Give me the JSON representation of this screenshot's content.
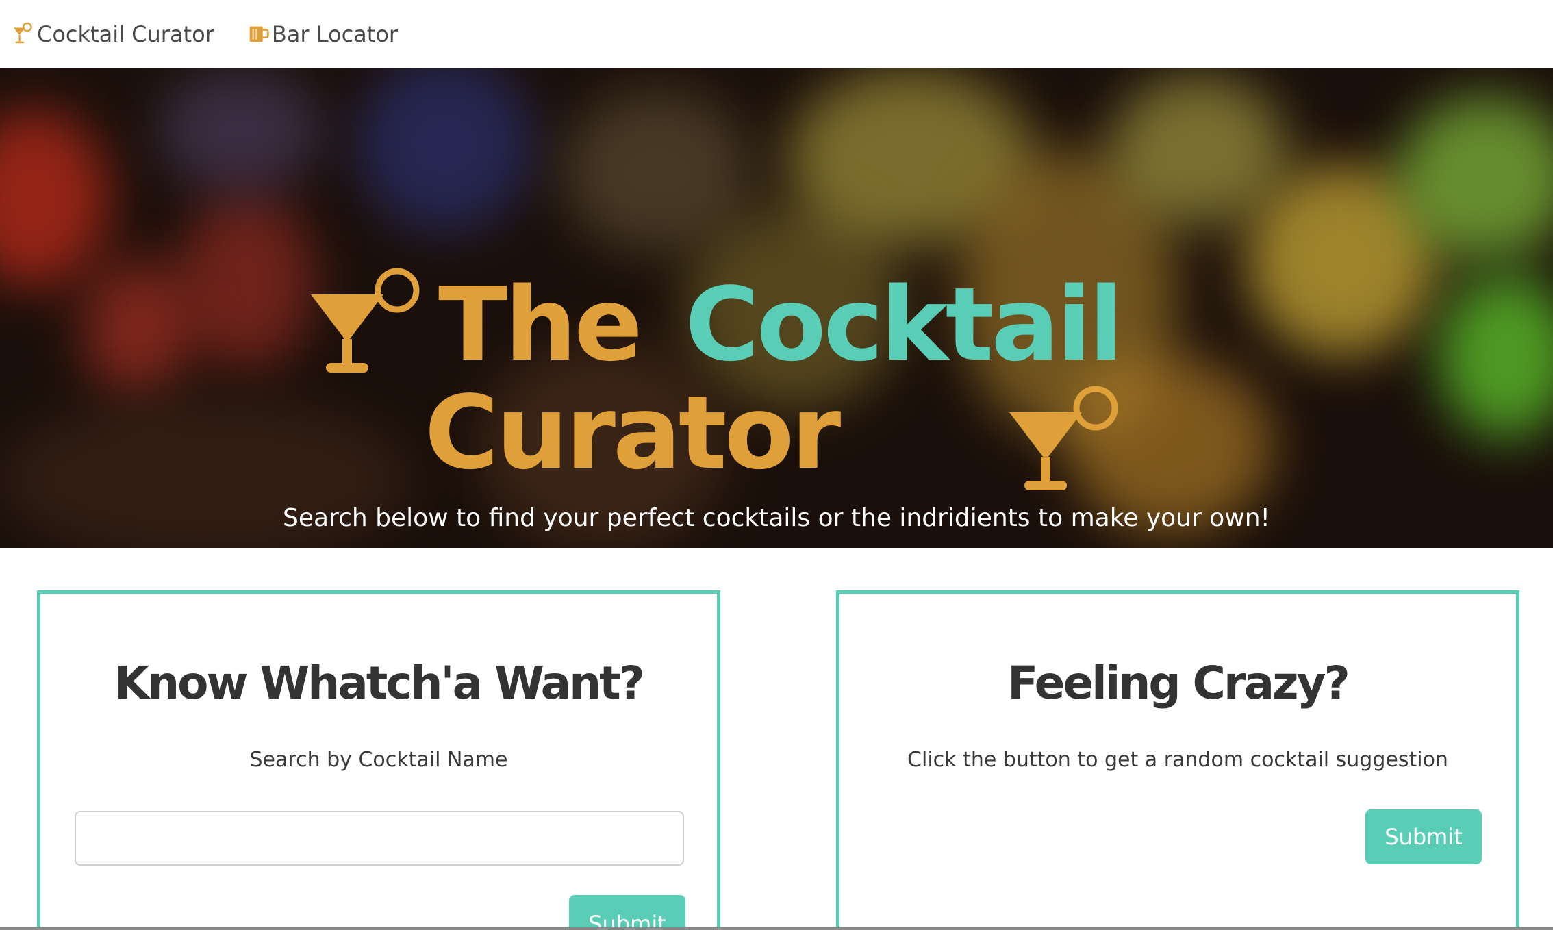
{
  "nav": {
    "items": [
      {
        "label": "Cocktail Curator",
        "icon": "cocktail-glass-icon"
      },
      {
        "label": "Bar Locator",
        "icon": "beer-mug-icon"
      }
    ]
  },
  "hero": {
    "title_word_1": "The",
    "title_word_2": "Cocktail",
    "title_word_3": "Curator",
    "subtitle": "Search below to find your perfect cocktails or the indridients to make your own!"
  },
  "cards": {
    "left": {
      "heading": "Know Whatch'a Want?",
      "subheading": "Search by Cocktail Name",
      "input_value": "",
      "input_placeholder": "",
      "button_label": "Submit"
    },
    "right": {
      "heading": "Feeling Crazy?",
      "subheading": "Click the button to get a random cocktail suggestion",
      "button_label": "Submit"
    }
  },
  "colors": {
    "gold": "#dfa03a",
    "teal": "#5acdb6",
    "text": "#333333"
  }
}
